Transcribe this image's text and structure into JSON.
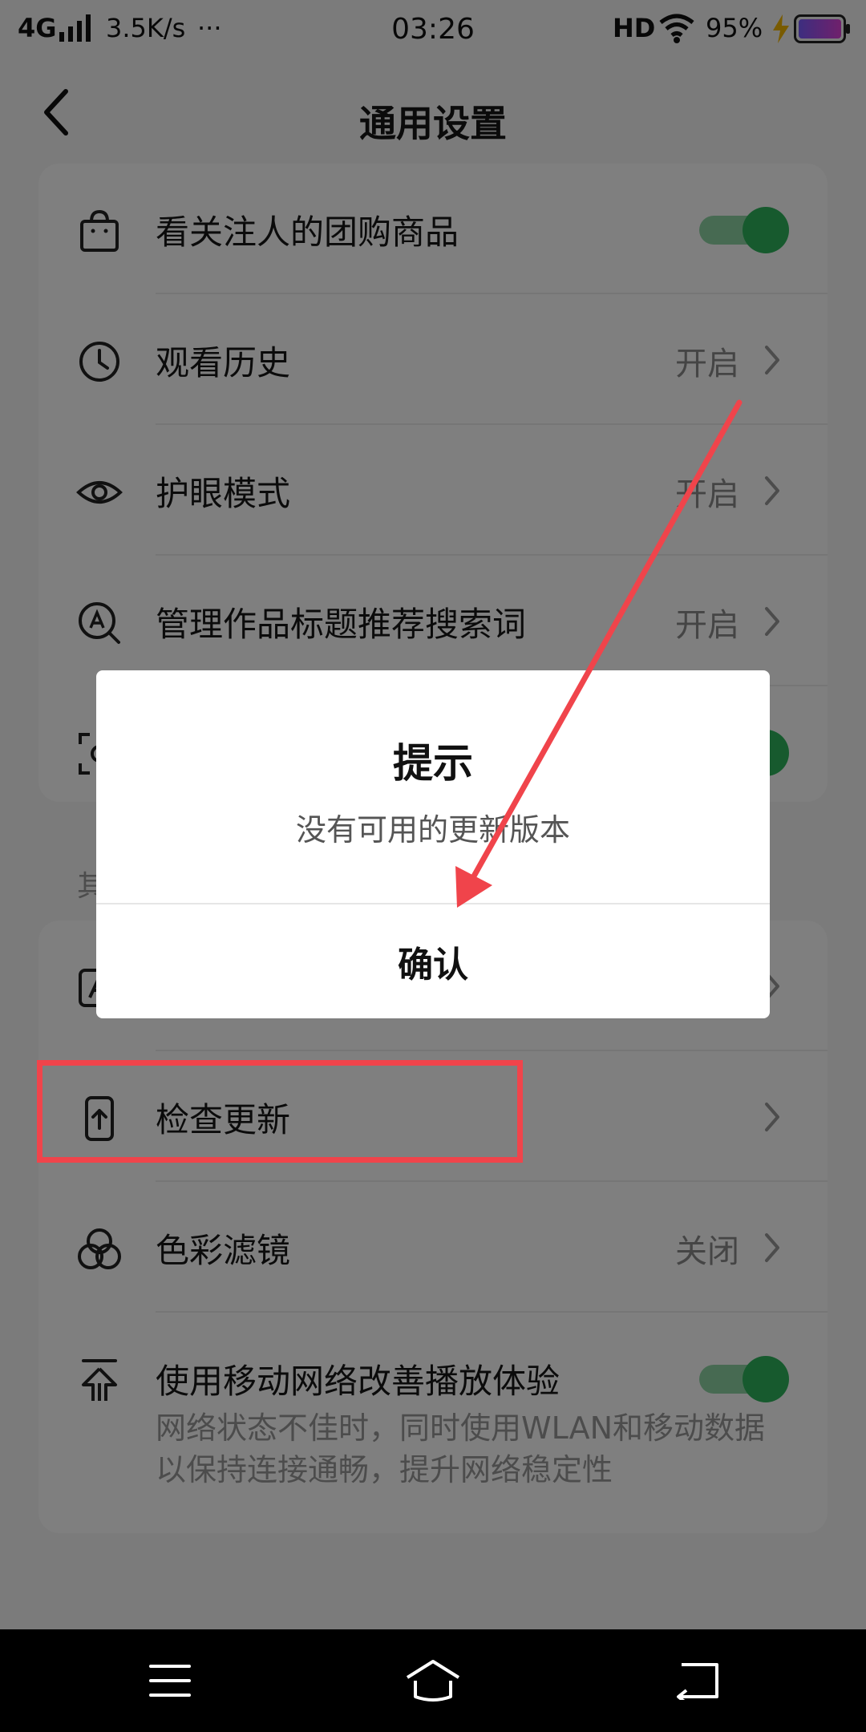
{
  "status_bar": {
    "network": "4G",
    "speed": "3.5K/s",
    "more": "···",
    "time": "03:26",
    "hd": "HD",
    "battery": "95%"
  },
  "header": {
    "title": "通用设置"
  },
  "settings_top": [
    {
      "label": "看关注人的团购商品",
      "type": "toggle",
      "on": true,
      "icon": "shopping-bag-icon"
    },
    {
      "label": "观看历史",
      "value": "开启",
      "type": "link",
      "icon": "clock-icon"
    },
    {
      "label": "护眼模式",
      "value": "开启",
      "type": "link",
      "icon": "eye-icon"
    },
    {
      "label": "管理作品标题推荐搜索词",
      "value": "开启",
      "type": "link",
      "icon": "search-a-icon"
    }
  ],
  "section_label": "其",
  "settings_bottom": [
    {
      "label": "检查更新",
      "type": "link",
      "icon": "phone-upload-icon"
    },
    {
      "label": "色彩滤镜",
      "value": "关闭",
      "type": "link",
      "icon": "color-filter-icon"
    },
    {
      "label": "使用移动网络改善播放体验",
      "type": "toggle",
      "on": true,
      "icon": "upload-arrow-icon",
      "description_line1": "网络状态不佳时，同时使用WLAN和移动数据",
      "description_line2": "以保持连接通畅，提升网络稳定性"
    }
  ],
  "dialog": {
    "title": "提示",
    "message": "没有可用的更新版本",
    "confirm": "确认"
  },
  "colors": {
    "toggle_on": "#2fb55d",
    "annotation_red": "#f0444b",
    "overlay": "rgba(0,0,0,0.5)"
  }
}
